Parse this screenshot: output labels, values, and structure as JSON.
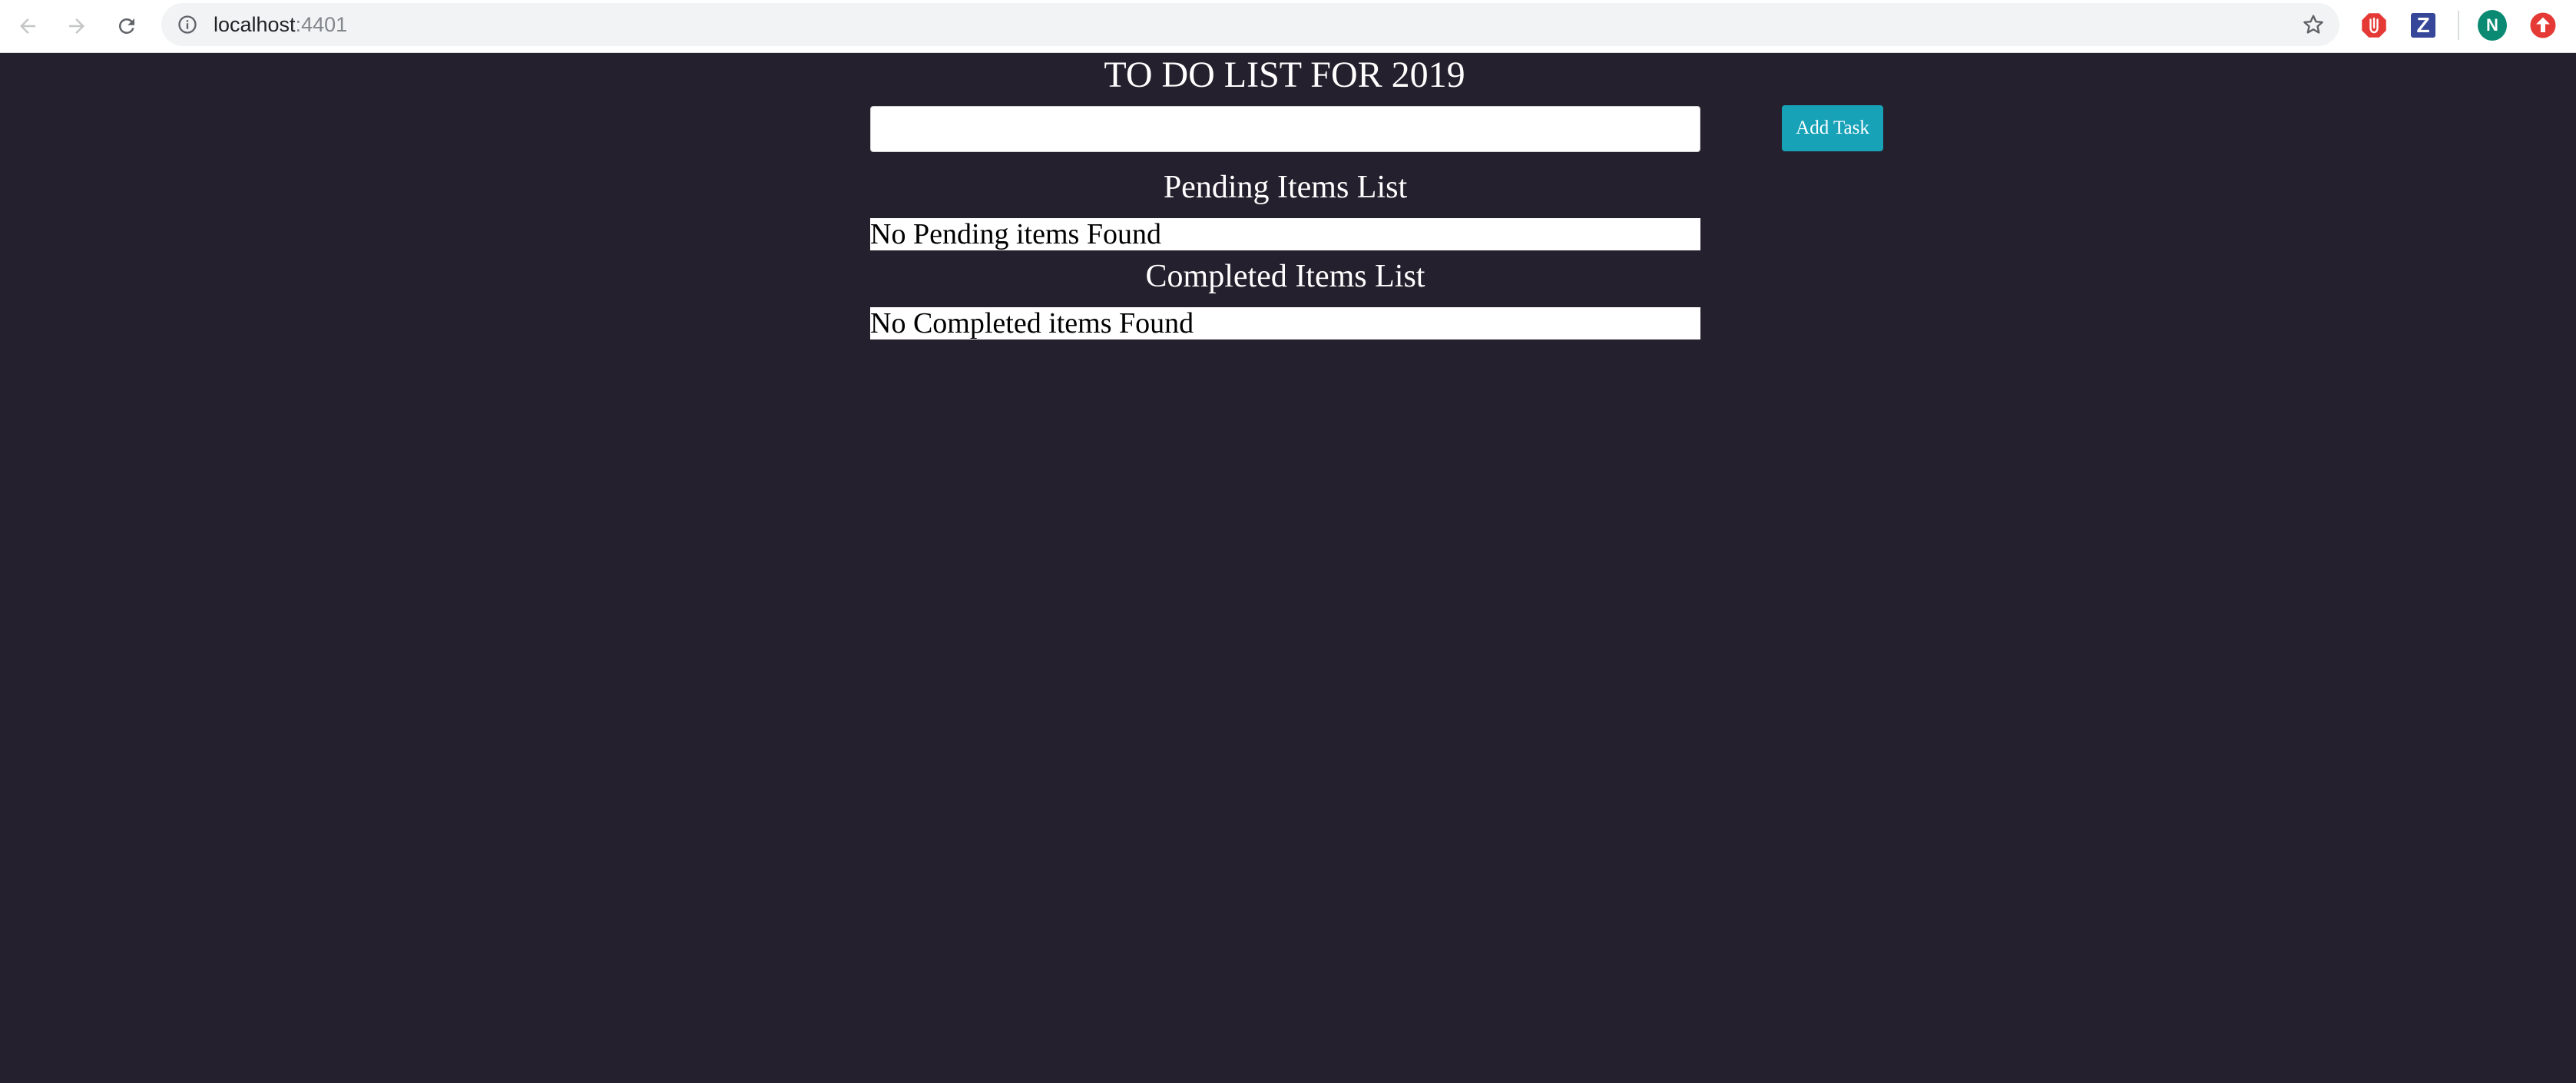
{
  "browser": {
    "url_host": "localhost",
    "url_port": ":4401",
    "profile_initial": "N",
    "extensions": [
      "adblock-icon",
      "zotero-icon",
      "profile-avatar",
      "update-icon"
    ]
  },
  "app": {
    "title": "TO DO LIST FOR 2019",
    "task_input": {
      "value": "",
      "placeholder": ""
    },
    "add_task_label": "Add Task",
    "pending": {
      "heading": "Pending Items List",
      "empty_text": "No Pending items Found"
    },
    "completed": {
      "heading": "Completed Items List",
      "empty_text": "No Completed items Found"
    }
  },
  "colors": {
    "background": "#25202d",
    "accent_button": "#17a2b8",
    "text_light": "#ffffff",
    "row_background": "#ffffff"
  }
}
